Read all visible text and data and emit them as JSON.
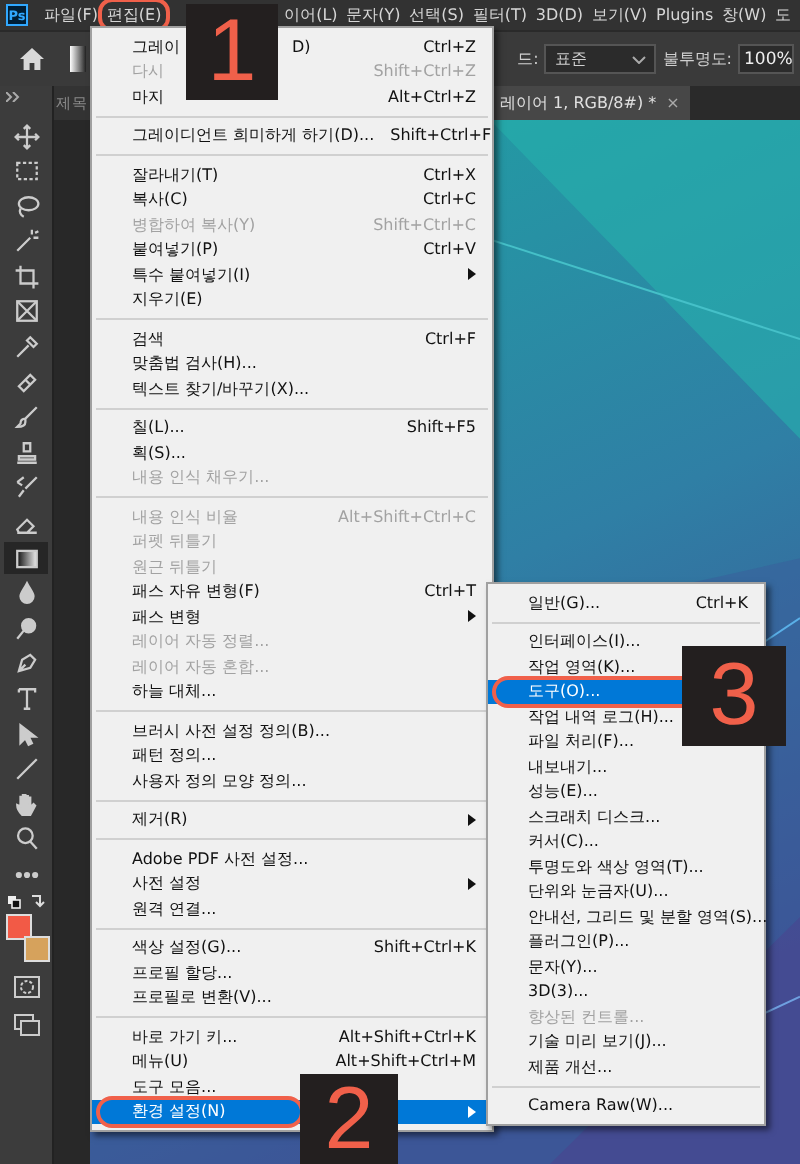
{
  "app_logo": "Ps",
  "menubar": [
    {
      "label": "파일(F)",
      "annotated": false
    },
    {
      "label": "편집(E)",
      "annotated": true
    },
    {
      "label": "이어(L)",
      "annotated": false
    },
    {
      "label": "문자(Y)",
      "annotated": false
    },
    {
      "label": "선택(S)",
      "annotated": false
    },
    {
      "label": "필터(T)",
      "annotated": false
    },
    {
      "label": "3D(D)",
      "annotated": false
    },
    {
      "label": "보기(V)",
      "annotated": false
    },
    {
      "label": "Plugins",
      "annotated": false
    },
    {
      "label": "창(W)",
      "annotated": false
    },
    {
      "label": "도",
      "annotated": false
    }
  ],
  "options_bar": {
    "mode_label": "드:",
    "mode_value": "표준",
    "opacity_label": "불투명도:",
    "opacity_value": "100%"
  },
  "tabs": [
    {
      "label": "제목",
      "selected": false
    },
    {
      "label": "레이어 1, RGB/8#) *",
      "close": "×",
      "selected": true
    }
  ],
  "toolbar": {
    "tools": [
      {
        "selected": false
      },
      {
        "selected": false
      },
      {
        "selected": false
      },
      {
        "selected": false
      },
      {
        "selected": false
      },
      {
        "selected": false
      },
      {
        "selected": false
      },
      {
        "selected": false
      },
      {
        "selected": false
      },
      {
        "selected": false
      },
      {
        "selected": false
      },
      {
        "selected": false
      },
      {
        "selected": true
      },
      {
        "selected": false
      },
      {
        "selected": false
      },
      {
        "selected": false
      },
      {
        "selected": false
      },
      {
        "selected": false
      },
      {
        "selected": false
      },
      {
        "selected": false
      },
      {
        "selected": false
      },
      {
        "selected": false
      }
    ],
    "swatches": [
      {
        "color": "#f25a46"
      },
      {
        "color": "#d6a25c"
      }
    ]
  },
  "edit_menu": {
    "groups": [
      [
        {
          "label": "그레이",
          "tail": "D)",
          "shortcut": "Ctrl+Z",
          "disabled": false,
          "selected": false
        },
        {
          "label": "다시",
          "shortcut": "Shift+Ctrl+Z",
          "disabled": true,
          "selected": false
        },
        {
          "label": "마지",
          "shortcut": "Alt+Ctrl+Z",
          "disabled": false,
          "selected": false
        }
      ],
      [
        {
          "label": "그레이디언트 희미하게 하기(D)...",
          "shortcut": "Shift+Ctrl+F",
          "disabled": false,
          "selected": false
        }
      ],
      [
        {
          "label": "잘라내기(T)",
          "shortcut": "Ctrl+X",
          "disabled": false,
          "selected": false
        },
        {
          "label": "복사(C)",
          "shortcut": "Ctrl+C",
          "disabled": false,
          "selected": false
        },
        {
          "label": "병합하여 복사(Y)",
          "shortcut": "Shift+Ctrl+C",
          "disabled": true,
          "selected": false
        },
        {
          "label": "붙여넣기(P)",
          "shortcut": "Ctrl+V",
          "disabled": false,
          "selected": false
        },
        {
          "label": "특수 붙여넣기(I)",
          "submenu": true,
          "disabled": false,
          "selected": false
        },
        {
          "label": "지우기(E)",
          "disabled": false,
          "selected": false
        }
      ],
      [
        {
          "label": "검색",
          "shortcut": "Ctrl+F",
          "disabled": false,
          "selected": false
        },
        {
          "label": "맞춤법 검사(H)...",
          "disabled": false,
          "selected": false
        },
        {
          "label": "텍스트 찾기/바꾸기(X)...",
          "disabled": false,
          "selected": false
        }
      ],
      [
        {
          "label": "칠(L)...",
          "shortcut": "Shift+F5",
          "disabled": false,
          "selected": false
        },
        {
          "label": "획(S)...",
          "disabled": false,
          "selected": false
        },
        {
          "label": "내용 인식 채우기...",
          "disabled": true,
          "selected": false
        }
      ],
      [
        {
          "label": "내용 인식 비율",
          "shortcut": "Alt+Shift+Ctrl+C",
          "disabled": true,
          "selected": false
        },
        {
          "label": "퍼펫 뒤틀기",
          "disabled": true,
          "selected": false
        },
        {
          "label": "원근 뒤틀기",
          "disabled": true,
          "selected": false
        },
        {
          "label": "패스 자유 변형(F)",
          "shortcut": "Ctrl+T",
          "disabled": false,
          "selected": false
        },
        {
          "label": "패스 변형",
          "submenu": true,
          "disabled": false,
          "selected": false
        },
        {
          "label": "레이어 자동 정렬...",
          "disabled": true,
          "selected": false
        },
        {
          "label": "레이어 자동 혼합...",
          "disabled": true,
          "selected": false
        },
        {
          "label": "하늘 대체...",
          "disabled": false,
          "selected": false
        }
      ],
      [
        {
          "label": "브러시 사전 설정 정의(B)...",
          "disabled": false,
          "selected": false
        },
        {
          "label": "패턴 정의...",
          "disabled": false,
          "selected": false
        },
        {
          "label": "사용자 정의 모양 정의...",
          "disabled": false,
          "selected": false
        }
      ],
      [
        {
          "label": "제거(R)",
          "submenu": true,
          "disabled": false,
          "selected": false
        }
      ],
      [
        {
          "label": "Adobe PDF 사전 설정...",
          "disabled": false,
          "selected": false
        },
        {
          "label": "사전 설정",
          "submenu": true,
          "disabled": false,
          "selected": false
        },
        {
          "label": "원격 연결...",
          "disabled": false,
          "selected": false
        }
      ],
      [
        {
          "label": "색상 설정(G)...",
          "shortcut": "Shift+Ctrl+K",
          "disabled": false,
          "selected": false
        },
        {
          "label": "프로필 할당...",
          "disabled": false,
          "selected": false
        },
        {
          "label": "프로필로 변환(V)...",
          "disabled": false,
          "selected": false
        }
      ],
      [
        {
          "label": "바로 가기 키...",
          "shortcut": "Alt+Shift+Ctrl+K",
          "disabled": false,
          "selected": false
        },
        {
          "label": "메뉴(U)",
          "shortcut": "Alt+Shift+Ctrl+M",
          "disabled": false,
          "selected": false
        },
        {
          "label": "도구 모음...",
          "disabled": false,
          "selected": false
        },
        {
          "label": "환경 설정(N)",
          "submenu": true,
          "disabled": false,
          "selected": true,
          "annotated": true
        }
      ]
    ]
  },
  "preferences_submenu": {
    "groups": [
      [
        {
          "label": "일반(G)...",
          "shortcut": "Ctrl+K",
          "disabled": false,
          "selected": false
        }
      ],
      [
        {
          "label": "인터페이스(I)...",
          "disabled": false,
          "selected": false
        },
        {
          "label": "작업 영역(K)...",
          "disabled": false,
          "selected": false
        },
        {
          "label": "도구(O)...",
          "disabled": false,
          "selected": true,
          "annotated": true
        },
        {
          "label": "작업 내역 로그(H)...",
          "disabled": false,
          "selected": false
        },
        {
          "label": "파일 처리(F)...",
          "disabled": false,
          "selected": false
        },
        {
          "label": "내보내기...",
          "disabled": false,
          "selected": false
        },
        {
          "label": "성능(E)...",
          "disabled": false,
          "selected": false
        },
        {
          "label": "스크래치 디스크...",
          "disabled": false,
          "selected": false
        },
        {
          "label": "커서(C)...",
          "disabled": false,
          "selected": false
        },
        {
          "label": "투명도와 색상 영역(T)...",
          "disabled": false,
          "selected": false
        },
        {
          "label": "단위와 눈금자(U)...",
          "disabled": false,
          "selected": false
        },
        {
          "label": "안내선, 그리드 및 분할 영역(S)...",
          "disabled": false,
          "selected": false
        },
        {
          "label": "플러그인(P)...",
          "disabled": false,
          "selected": false
        },
        {
          "label": "문자(Y)...",
          "disabled": false,
          "selected": false
        },
        {
          "label": "3D(3)...",
          "disabled": false,
          "selected": false
        },
        {
          "label": "향상된 컨트롤...",
          "disabled": true,
          "selected": false
        },
        {
          "label": "기술 미리 보기(J)...",
          "disabled": false,
          "selected": false
        },
        {
          "label": "제품 개선...",
          "disabled": false,
          "selected": false
        }
      ],
      [
        {
          "label": "Camera Raw(W)...",
          "disabled": false,
          "selected": false
        }
      ]
    ]
  },
  "callouts": [
    {
      "number": "1"
    },
    {
      "number": "2"
    },
    {
      "number": "3"
    }
  ]
}
